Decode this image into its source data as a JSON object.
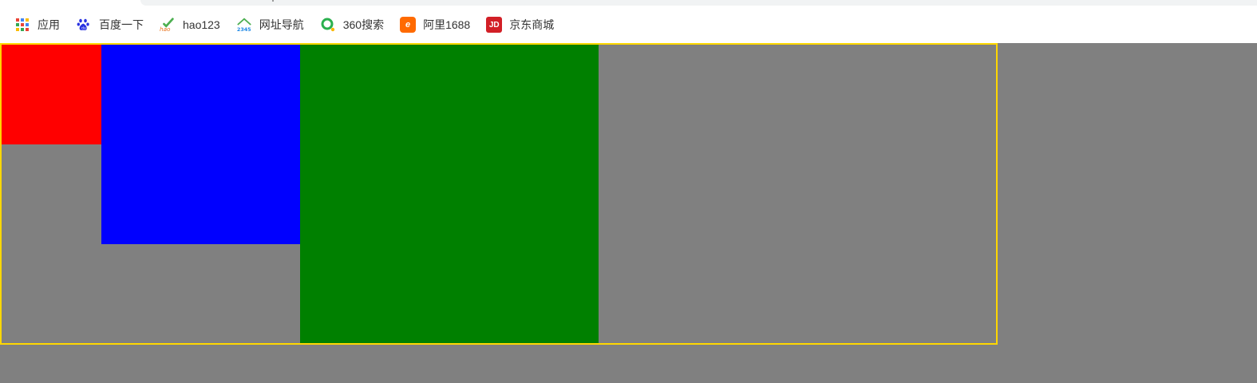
{
  "bookmarks_bar": {
    "items": [
      {
        "label": "应用",
        "icon": "apps-grid-icon"
      },
      {
        "label": "百度一下",
        "icon": "baidu-paw-icon"
      },
      {
        "label": "hao123",
        "icon": "hao123-icon"
      },
      {
        "label": "网址导航",
        "icon": "2345-house-icon"
      },
      {
        "label": "360搜索",
        "icon": "360-search-icon"
      },
      {
        "label": "阿里1688",
        "icon": "alibaba-1688-icon"
      },
      {
        "label": "京东商城",
        "icon": "jd-icon"
      }
    ],
    "jd_icon_text": "JD",
    "ali_icon_text": "e"
  },
  "page": {
    "background_color": "#808080",
    "container_border_color": "#ffd700",
    "boxes": [
      {
        "name": "red-box",
        "color": "#ff0000"
      },
      {
        "name": "blue-box",
        "color": "#0000ff"
      },
      {
        "name": "green-box",
        "color": "#008000"
      }
    ]
  }
}
